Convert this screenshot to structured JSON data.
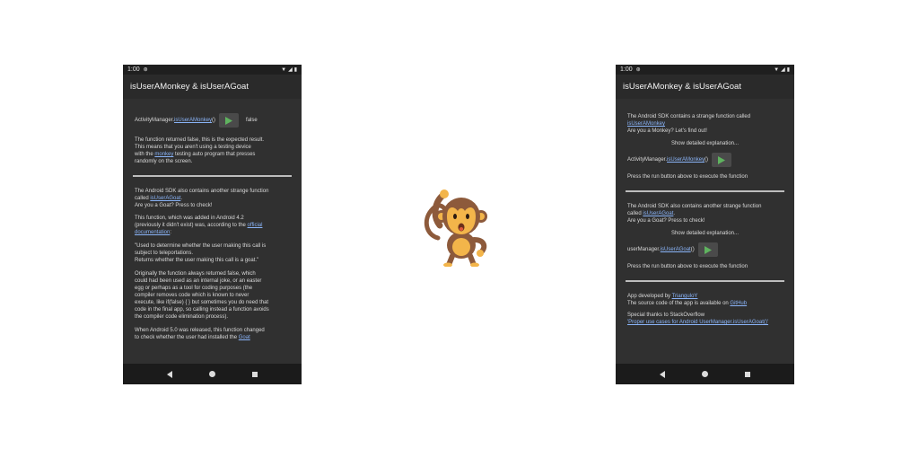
{
  "left_phone": {
    "status_time": "1:00",
    "title": "isUserAMonkey & isUserAGoat",
    "call_prefix": "ActivityManager.",
    "call_link": "isUserAMonkey",
    "call_suffix": "()",
    "result": "false",
    "p1_line1": "The function returned false, this is the expected result.",
    "p1_line2": "This means that you aren't using a testing device",
    "p1_line3_prefix": "with the ",
    "p1_line3_link": "monkey",
    "p1_line3_suffix": " testing auto program that presses",
    "p1_line4": "randomly on the screen.",
    "p2_line1": "The Android SDK also contains another strange function",
    "p2_line2_prefix": "called ",
    "p2_line2_link": "isUserAGoat",
    "p2_line2_suffix": ".",
    "p2_line3": "Are you a Goat? Press to check!",
    "p3_line1": "This function, which was added in Android 4.2",
    "p3_line2_prefix": "(previously it didn't exist) was, according to the ",
    "p3_line2_link": "official",
    "p3_line3_link": "documentation",
    "p3_line3_suffix": ":",
    "p4_line1": "\"Used to determine whether the user making this call is",
    "p4_line2": "subject to teleportations.",
    "p4_line3": "Returns whether the user making this call is a goat.\"",
    "p5_line1": "Originally the function always returned false, which",
    "p5_line2": "could had been used as an internal joke, or an easter",
    "p5_line3": "egg or perhaps as a tool for coding purposes (the",
    "p5_line4": "compiler removes code which is known to never",
    "p5_line5": "execute, like if(false) { } but sometimes you do need that",
    "p5_line6": "code in the final app, so calling instead a function avoids",
    "p5_line7": "the compiler code elimination process).",
    "p6_line1": "When Android 5.0 was released, this function changed",
    "p6_line2_prefix": "to check whether the user had installed the ",
    "p6_line2_link": "Goat"
  },
  "right_phone": {
    "status_time": "1:00",
    "title": "isUserAMonkey & isUserAGoat",
    "intro_line1": "The Android SDK contains a strange function called",
    "intro_line2_link": "isUserAMonkey",
    "intro_line3": "Are you a Monkey? Let's find out!",
    "show_explanation_1": "Show detailed explanation...",
    "call1_prefix": "ActivityManager.",
    "call1_link": "isUserAMonkey",
    "call1_suffix": "()",
    "press_run_1": "Press the run button above to execute the function",
    "goat_line1": "The Android SDK also contains another strange function",
    "goat_line2_prefix": "called ",
    "goat_line2_link": "isUserAGoat",
    "goat_line2_suffix": ".",
    "goat_line3": "Are you a Goat? Press to check!",
    "show_explanation_2": "Show detailed explanation...",
    "call2_prefix": "userManager.",
    "call2_link": "isUserAGoat",
    "call2_suffix": "()",
    "press_run_2": "Press the run button above to execute the function",
    "dev_prefix": "App developed by ",
    "dev_link": "TrianguloY",
    "source_prefix": "The source code of the app is available on ",
    "source_link": "GitHub",
    "thanks_line1": "Special thanks to StackOverflow",
    "thanks_line2_link": "'Proper use cases for Android UserManager.isUserAGoat()'"
  },
  "mascot": {
    "icon": "monkey-emoji-icon",
    "glyph": "🐒"
  },
  "colors": {
    "screen_bg": "#303030",
    "appbar_bg": "#2a2a2a",
    "link": "#8ab4f8",
    "play_green": "#5fb35f"
  }
}
